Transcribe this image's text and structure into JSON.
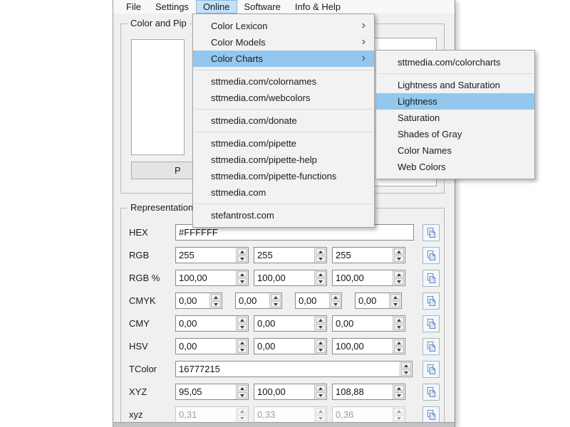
{
  "menu_bar": {
    "items": [
      {
        "label": "File"
      },
      {
        "label": "Settings"
      },
      {
        "label": "Online",
        "active": true
      },
      {
        "label": "Software"
      },
      {
        "label": "Info & Help"
      }
    ]
  },
  "online_menu": {
    "submenu_arrow": "›",
    "color_lexicon": "Color Lexicon",
    "color_models": "Color Models",
    "color_charts": "Color Charts",
    "colornames": "sttmedia.com/colornames",
    "webcolors": "sttmedia.com/webcolors",
    "donate": "sttmedia.com/donate",
    "pipette": "sttmedia.com/pipette",
    "pipette_help": "sttmedia.com/pipette-help",
    "pipette_functions": "sttmedia.com/pipette-functions",
    "sttmedia": "sttmedia.com",
    "stefantrost": "stefantrost.com"
  },
  "color_charts_submenu": {
    "colorcharts": "sttmedia.com/colorcharts",
    "lightness_and_saturation": "Lightness and Saturation",
    "lightness": "Lightness",
    "saturation": "Saturation",
    "shades_of_gray": "Shades of Gray",
    "color_names": "Color Names",
    "web_colors": "Web Colors"
  },
  "color_group": {
    "label": "Color and Pip",
    "pick_button_label": "P"
  },
  "representation": {
    "label": "Representation",
    "rows": [
      {
        "label": "HEX",
        "values": [
          "#FFFFFF"
        ]
      },
      {
        "label": "RGB",
        "values": [
          "255",
          "255",
          "255"
        ]
      },
      {
        "label": "RGB %",
        "values": [
          "100,00",
          "100,00",
          "100,00"
        ]
      },
      {
        "label": "CMYK",
        "values": [
          "0,00",
          "0,00",
          "0,00",
          "0,00"
        ]
      },
      {
        "label": "CMY",
        "values": [
          "0,00",
          "0,00",
          "0,00"
        ]
      },
      {
        "label": "HSV",
        "values": [
          "0,00",
          "0,00",
          "100,00"
        ]
      },
      {
        "label": "TColor",
        "values": [
          "16777215"
        ]
      },
      {
        "label": "XYZ",
        "values": [
          "95,05",
          "100,00",
          "108,88"
        ]
      },
      {
        "label": "xyz",
        "values": [
          "0,31",
          "0,33",
          "0,36"
        ],
        "disabled": true
      }
    ]
  },
  "colors": {
    "menu_item_highlight": "#93c7ee",
    "menubar_highlight": "#c4e1f6",
    "window_background": "#f0f0f0",
    "copy_icon_blue": "#5b82ba"
  }
}
